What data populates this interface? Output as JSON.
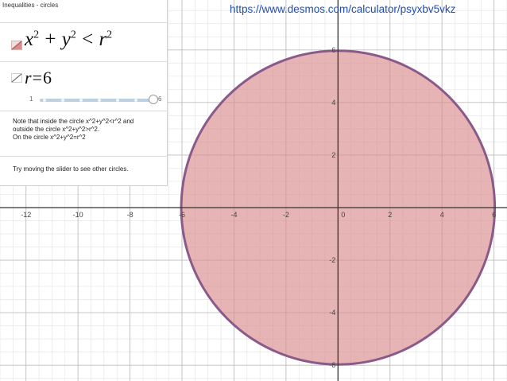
{
  "window": {
    "title": "Inequalities - circles",
    "url": "https://www.desmos.com/calculator/psyxbv5vkz"
  },
  "expressions": [
    {
      "type": "inequality",
      "parts": [
        "x",
        "2",
        "+",
        "y",
        "2",
        "<",
        "r",
        "2"
      ],
      "fill_color": "#d98c8c",
      "stroke_color": "#8a5a8a"
    },
    {
      "type": "slider",
      "variable": "r",
      "equals": "=",
      "value": "6",
      "min_label": "1",
      "max_label": "6",
      "value_fraction": 1.0
    }
  ],
  "note": {
    "lines": [
      "Note that inside the circle x^2+y^2<r^2 and",
      "outside the circle x^2+y^2>r^2.",
      "On the circle x^2+y^2=r^2"
    ]
  },
  "tip": "Try moving the slider to see other circles.",
  "icons": {
    "inequality_style": "shaded-inequality-icon",
    "line_style": "line-style-icon"
  },
  "graph": {
    "x_range": [
      -13,
      6.5
    ],
    "y_range": [
      -6.6,
      7.9
    ],
    "x_ticks": [
      "-12",
      "-10",
      "-8",
      "-6",
      "-4",
      "-2",
      "0",
      "2",
      "4",
      "6"
    ],
    "y_ticks": [
      "6",
      "4",
      "2",
      "-2",
      "-4",
      "-6"
    ],
    "circle": {
      "cx": 0,
      "cy": 0,
      "r": 6
    },
    "colors": {
      "fill": "#d98c8c",
      "stroke": "#8a5a8a",
      "minor_grid": "#e7e7e7",
      "major_grid": "#bdbdbd",
      "axis": "#333333",
      "tick_text": "#444444"
    }
  }
}
